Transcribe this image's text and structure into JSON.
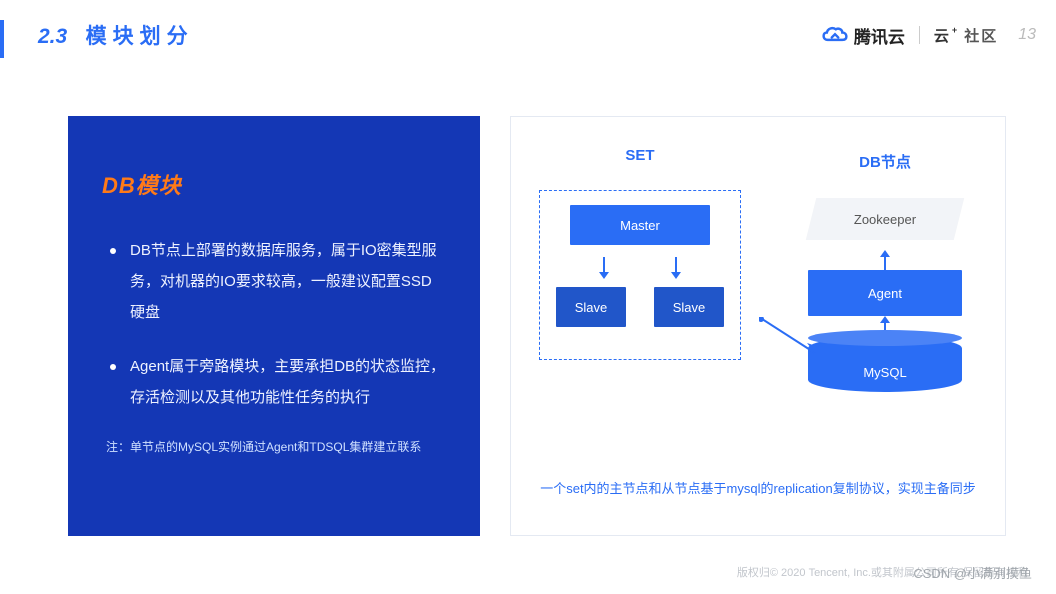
{
  "header": {
    "section_number": "2.3",
    "section_title": "模块划分",
    "brand_name": "腾讯云",
    "community_yun": "云",
    "community_plus": "+",
    "community_txt": "社区",
    "page_number": "13"
  },
  "left": {
    "title": "DB模块",
    "bullets": [
      "DB节点上部署的数据库服务，属于IO密集型服务，对机器的IO要求较高，一般建议配置SSD硬盘",
      "Agent属于旁路模块，主要承担DB的状态监控，存活检测以及其他功能性任务的执行"
    ],
    "note": "注：单节点的MySQL实例通过Agent和TDSQL集群建立联系"
  },
  "diagram": {
    "set_title": "SET",
    "db_title": "DB节点",
    "master": "Master",
    "slave1": "Slave",
    "slave2": "Slave",
    "zookeeper": "Zookeeper",
    "agent": "Agent",
    "mysql": "MySQL",
    "caption": "一个set内的主节点和从节点基于mysql的replication复制协议，实现主备同步"
  },
  "footer": {
    "copyright": "版权归© 2020 Tencent, Inc.或其附属公司所有 保留所有权利",
    "watermark": "CSDN @小满别摸鱼"
  }
}
